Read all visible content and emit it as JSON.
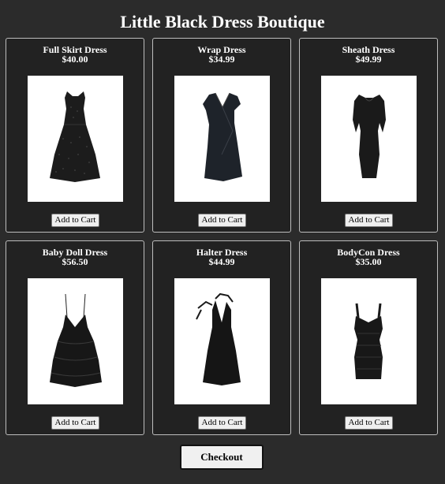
{
  "page": {
    "title": "Little Black Dress Boutique"
  },
  "products": [
    {
      "name": "Full Skirt Dress",
      "price": "$40.00",
      "button_label": "Add to Cart",
      "image_icon": "full-skirt-dress-icon"
    },
    {
      "name": "Wrap Dress",
      "price": "$34.99",
      "button_label": "Add to Cart",
      "image_icon": "wrap-dress-icon"
    },
    {
      "name": "Sheath Dress",
      "price": "$49.99",
      "button_label": "Add to Cart",
      "image_icon": "sheath-dress-icon"
    },
    {
      "name": "Baby Doll Dress",
      "price": "$56.50",
      "button_label": "Add to Cart",
      "image_icon": "baby-doll-dress-icon"
    },
    {
      "name": "Halter Dress",
      "price": "$44.99",
      "button_label": "Add to Cart",
      "image_icon": "halter-dress-icon"
    },
    {
      "name": "BodyCon Dress",
      "price": "$35.00",
      "button_label": "Add to Cart",
      "image_icon": "bodycon-dress-icon"
    }
  ],
  "checkout": {
    "label": "Checkout"
  },
  "colors": {
    "page_background": "#2b2b2b",
    "card_background": "#222222",
    "card_border": "#bdbdbd",
    "text": "#ffffff",
    "dress": "#1a1a1a"
  }
}
